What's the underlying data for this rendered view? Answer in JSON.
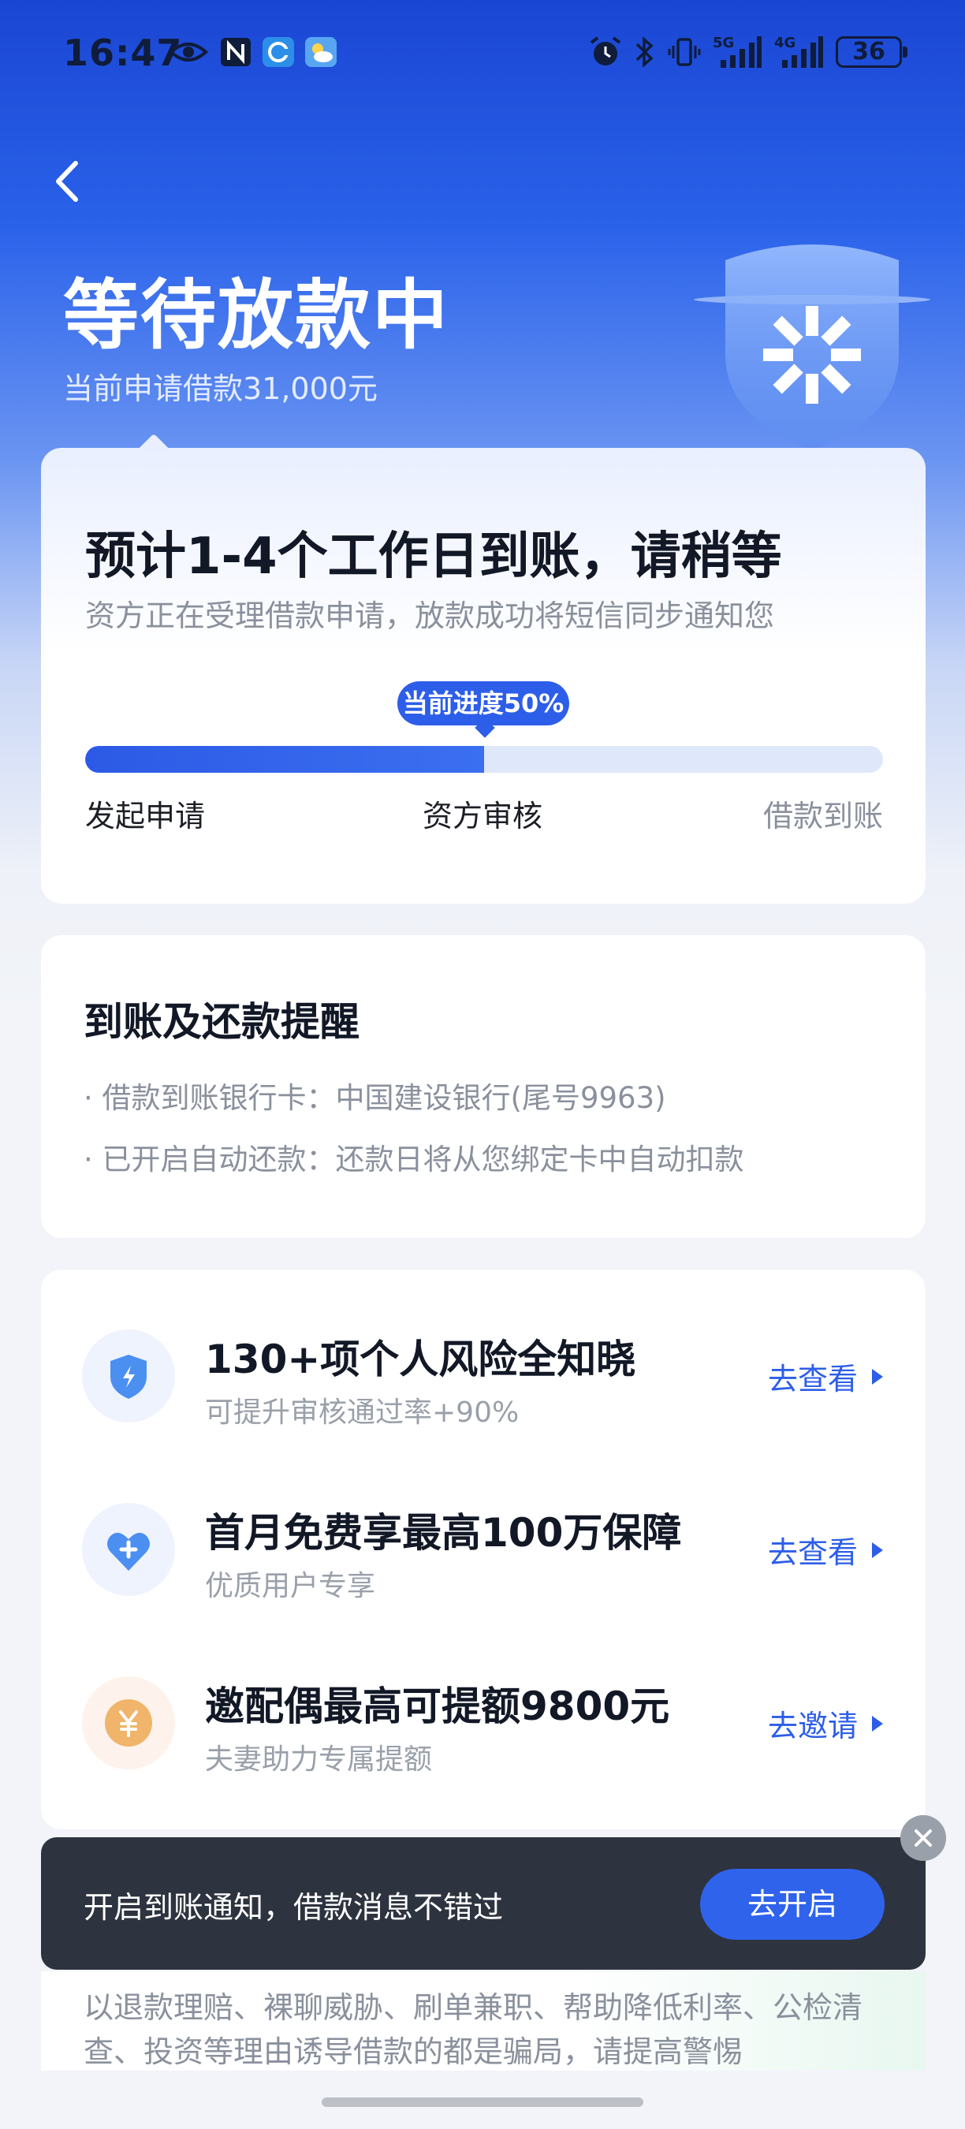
{
  "status_bar": {
    "time": "16:47",
    "battery": "36",
    "network_1": "5G",
    "network_2": "4G",
    "icons_left": [
      "eye-icon",
      "nfc-icon",
      "app-c-icon",
      "weather-icon"
    ],
    "icons_right": [
      "alarm-icon",
      "bluetooth-icon",
      "vibrate-icon",
      "signal-5g-icon",
      "signal-4g-icon",
      "battery-icon"
    ]
  },
  "header": {
    "back_icon": "chevron-left-icon",
    "title": "等待放款中",
    "subtitle": "当前申请借款31,000元",
    "badge_icon": "shield-logo-icon"
  },
  "progress_card": {
    "headline": "预计1-4个工作日到账，请稍等",
    "description": "资方正在受理借款申请，放款成功将短信同步通知您",
    "progress_label": "当前进度50%",
    "progress": 0.5,
    "steps": [
      "发起申请",
      "资方审核",
      "借款到账"
    ]
  },
  "reminder_card": {
    "title": "到账及还款提醒",
    "lines": [
      "借款到账银行卡：中国建设银行(尾号9963)",
      "已开启自动还款：还款日将从您绑定卡中自动扣款"
    ]
  },
  "promos": [
    {
      "title": "130+项个人风险全知晓",
      "subtitle": "可提升审核通过率+90%",
      "action": "去查看",
      "icon": "shield-bolt-icon"
    },
    {
      "title": "首月免费享最高100万保障",
      "subtitle": "优质用户专享",
      "action": "去查看",
      "icon": "heart-plus-icon"
    },
    {
      "title": "邀配偶最高可提额9800元",
      "subtitle": "夫妻助力专属提额",
      "action": "去邀请",
      "icon": "yen-coin-icon"
    }
  ],
  "notification_bar": {
    "text": "开启到账通知，借款消息不错过",
    "button": "去开启",
    "close_icon": "close-icon"
  },
  "warning": {
    "text": "以退款理赔、裸聊威胁、刷单兼职、帮助降低利率、公检清查、投资等理由诱导借款的都是骗局，请提高警惕"
  },
  "colors": {
    "brand_blue": "#2d5ee9",
    "hero_top": "#1a46d3",
    "notice_bg": "#2d333f"
  }
}
